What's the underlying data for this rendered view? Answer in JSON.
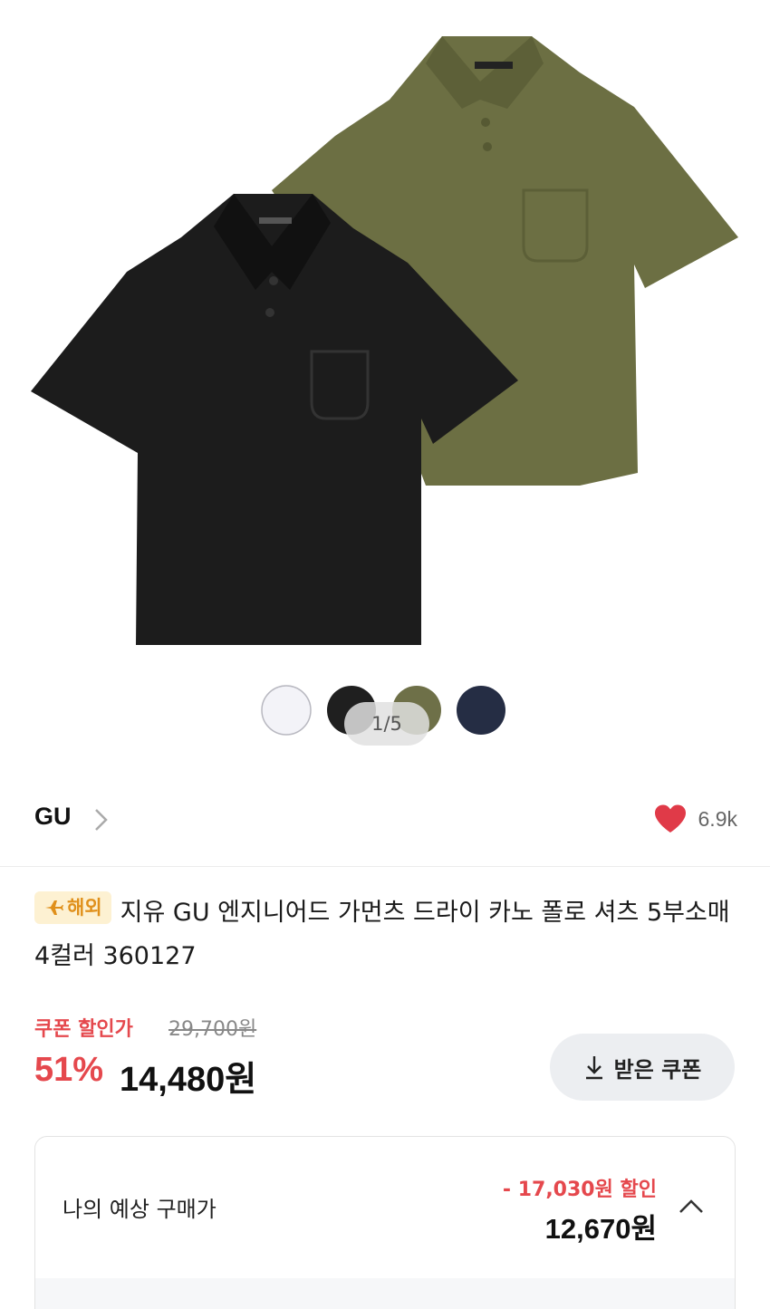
{
  "gallery": {
    "counter": "1/5",
    "swatches": [
      {
        "name": "white",
        "color": "#f3f3f8"
      },
      {
        "name": "black",
        "color": "#1f1f1f"
      },
      {
        "name": "olive",
        "color": "#6e7048"
      },
      {
        "name": "navy",
        "color": "#252d44"
      }
    ]
  },
  "brand": {
    "name": "GU",
    "likes": "6.9k",
    "heart_color": "#e03a48"
  },
  "product": {
    "tag": "해외",
    "title": "지유 GU 엔지니어드 가먼츠 드라이 카노 폴로 셔츠 5부소매 4컬러 360127"
  },
  "price": {
    "coupon_label": "쿠폰 할인가",
    "original": "29,700원",
    "discount_rate": "51%",
    "current": "14,480원",
    "coupon_button": "받은 쿠폰"
  },
  "estimate": {
    "label": "나의 예상 구매가",
    "discount": "- 17,030원 할인",
    "price": "12,670원"
  },
  "colors": {
    "accent_red": "#e5484d",
    "tag_bg": "#fdf1d2",
    "tag_text": "#e0901b"
  }
}
